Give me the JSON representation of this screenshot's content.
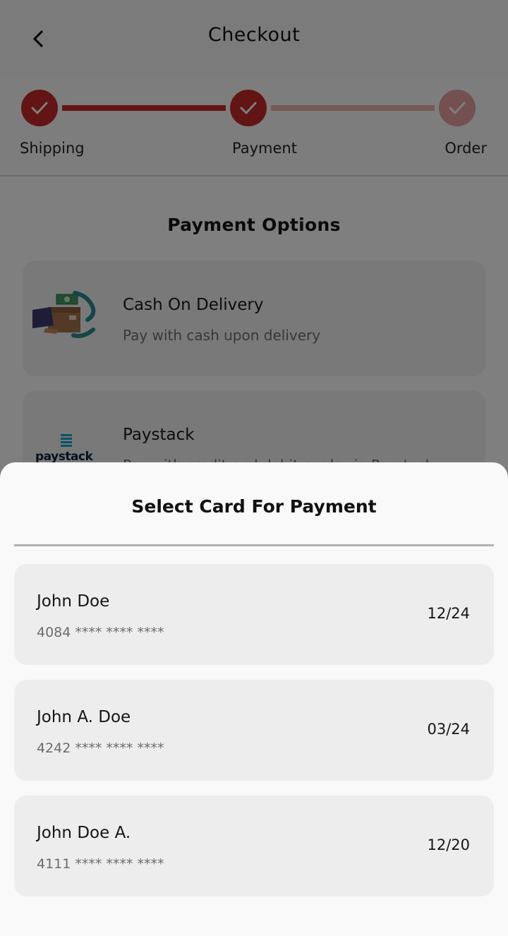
{
  "header": {
    "title": "Checkout"
  },
  "stepper": {
    "steps": [
      {
        "label": "Shipping",
        "status": "done"
      },
      {
        "label": "Payment",
        "status": "done"
      },
      {
        "label": "Order",
        "status": "pending"
      }
    ]
  },
  "payment_options": {
    "title": "Payment Options",
    "options": [
      {
        "title": "Cash On Delivery",
        "description": "Pay with cash upon delivery",
        "icon": "cash-delivery-icon"
      },
      {
        "title": "Paystack",
        "description": "Pay with credit and debit cards via Paystack",
        "icon": "paystack-logo",
        "logo_text": "paystack"
      }
    ]
  },
  "sheet": {
    "title": "Select Card For Payment",
    "cards": [
      {
        "name": "John Doe",
        "number": "4084 **** **** ****",
        "expiry": "12/24"
      },
      {
        "name": "John A. Doe",
        "number": "4242 **** **** ****",
        "expiry": "03/24"
      },
      {
        "name": "John Doe A.",
        "number": "4111 **** **** ****",
        "expiry": "12/20"
      }
    ]
  },
  "colors": {
    "accent": "#c62828",
    "accent_light": "#eab0b0",
    "sheet_bg": "#f9f9f9",
    "card_bg": "#ededed"
  }
}
